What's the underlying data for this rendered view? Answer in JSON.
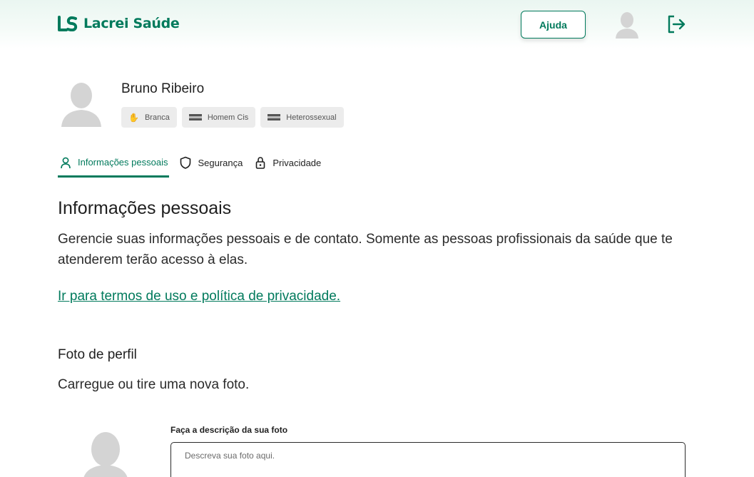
{
  "header": {
    "logo_text": "Lacrei Saúde",
    "help_label": "Ajuda",
    "brand_color": "#017a5c"
  },
  "profile": {
    "name": "Bruno Ribeiro",
    "chips": [
      {
        "icon": "hand-icon",
        "label": "Branca"
      },
      {
        "icon": "flag-icon",
        "label": "Homem Cis"
      },
      {
        "icon": "flag-icon",
        "label": "Heterossexual"
      }
    ]
  },
  "tabs": [
    {
      "icon": "user-icon",
      "label": "Informações pessoais",
      "active": true
    },
    {
      "icon": "shield-icon",
      "label": "Segurança",
      "active": false
    },
    {
      "icon": "lock-icon",
      "label": "Privacidade",
      "active": false
    }
  ],
  "section": {
    "title": "Informações pessoais",
    "description": "Gerencie suas informações pessoais e de contato. Somente as pessoas profissionais da saúde que te atenderem terão acesso à elas.",
    "terms_link": "Ir para termos de uso e política de privacidade."
  },
  "photo": {
    "title": "Foto de perfil",
    "description": "Carregue ou tire uma nova foto.",
    "description_label": "Faça a descrição da sua foto",
    "description_placeholder": "Descreva sua foto aqui.",
    "description_value": ""
  }
}
